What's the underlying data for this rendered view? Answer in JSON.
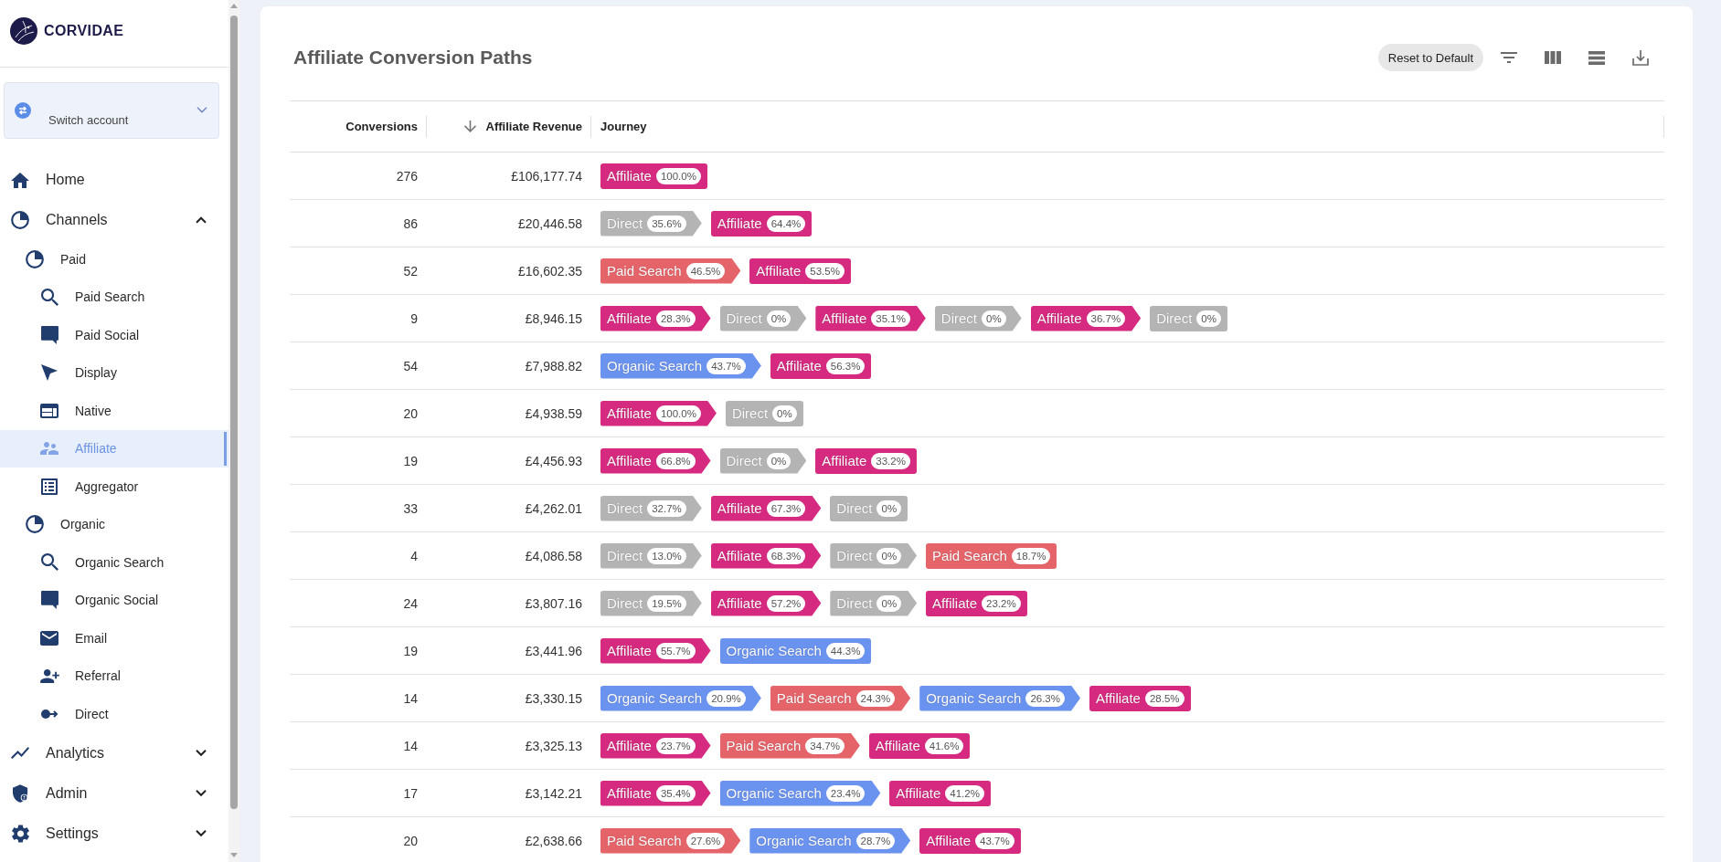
{
  "sidebar": {
    "brand": "CORVIDAE",
    "account_switcher": {
      "label": "Switch account",
      "expanded": false
    },
    "nav": [
      {
        "label": "Home",
        "selected": false
      },
      {
        "label": "Channels",
        "selected": false,
        "expanded": true,
        "children": [
          {
            "label": "Paid",
            "selected": false,
            "children": [
              {
                "label": "Paid Search",
                "selected": false
              },
              {
                "label": "Paid Social",
                "selected": false
              },
              {
                "label": "Display",
                "selected": false
              },
              {
                "label": "Native",
                "selected": false
              },
              {
                "label": "Affiliate",
                "selected": true
              },
              {
                "label": "Aggregator",
                "selected": false
              }
            ]
          },
          {
            "label": "Organic",
            "selected": false,
            "children": [
              {
                "label": "Organic Search",
                "selected": false
              },
              {
                "label": "Organic Social",
                "selected": false
              },
              {
                "label": "Email",
                "selected": false
              },
              {
                "label": "Referral",
                "selected": false
              },
              {
                "label": "Direct",
                "selected": false
              }
            ]
          }
        ]
      },
      {
        "label": "Analytics",
        "selected": false,
        "expanded": false
      },
      {
        "label": "Admin",
        "selected": false,
        "expanded": false
      },
      {
        "label": "Settings",
        "selected": false,
        "expanded": false
      }
    ]
  },
  "page": {
    "title": "Affiliate Conversion Paths",
    "reset_button": "Reset to Default",
    "table": {
      "columns": [
        {
          "label": "Conversions",
          "sorted_descending": false
        },
        {
          "label": "Affiliate Revenue",
          "sorted_descending": true
        },
        {
          "label": "Journey",
          "sorted_descending": false
        }
      ],
      "rows": [
        {
          "conversions": "276",
          "revenue": "£106,177.74",
          "journey": [
            {
              "channel": "Affiliate",
              "share": "100.0%",
              "color": "#d62a80"
            }
          ]
        },
        {
          "conversions": "86",
          "revenue": "£20,446.58",
          "journey": [
            {
              "channel": "Direct",
              "share": "35.6%",
              "color": "#b4b4b4"
            },
            {
              "channel": "Affiliate",
              "share": "64.4%",
              "color": "#d62a80"
            }
          ]
        },
        {
          "conversions": "52",
          "revenue": "£16,602.35",
          "journey": [
            {
              "channel": "Paid Search",
              "share": "46.5%",
              "color": "#e5646a"
            },
            {
              "channel": "Affiliate",
              "share": "53.5%",
              "color": "#d62a80"
            }
          ]
        },
        {
          "conversions": "9",
          "revenue": "£8,946.15",
          "journey": [
            {
              "channel": "Affiliate",
              "share": "28.3%",
              "color": "#d62a80"
            },
            {
              "channel": "Direct",
              "share": "0%",
              "color": "#b4b4b4"
            },
            {
              "channel": "Affiliate",
              "share": "35.1%",
              "color": "#d62a80"
            },
            {
              "channel": "Direct",
              "share": "0%",
              "color": "#b4b4b4"
            },
            {
              "channel": "Affiliate",
              "share": "36.7%",
              "color": "#d62a80"
            },
            {
              "channel": "Direct",
              "share": "0%",
              "color": "#b4b4b4"
            }
          ]
        },
        {
          "conversions": "54",
          "revenue": "£7,988.82",
          "journey": [
            {
              "channel": "Organic Search",
              "share": "43.7%",
              "color": "#6a92ef"
            },
            {
              "channel": "Affiliate",
              "share": "56.3%",
              "color": "#d62a80"
            }
          ]
        },
        {
          "conversions": "20",
          "revenue": "£4,938.59",
          "journey": [
            {
              "channel": "Affiliate",
              "share": "100.0%",
              "color": "#d62a80"
            },
            {
              "channel": "Direct",
              "share": "0%",
              "color": "#b4b4b4"
            }
          ]
        },
        {
          "conversions": "19",
          "revenue": "£4,456.93",
          "journey": [
            {
              "channel": "Affiliate",
              "share": "66.8%",
              "color": "#d62a80"
            },
            {
              "channel": "Direct",
              "share": "0%",
              "color": "#b4b4b4"
            },
            {
              "channel": "Affiliate",
              "share": "33.2%",
              "color": "#d62a80"
            }
          ]
        },
        {
          "conversions": "33",
          "revenue": "£4,262.01",
          "journey": [
            {
              "channel": "Direct",
              "share": "32.7%",
              "color": "#b4b4b4"
            },
            {
              "channel": "Affiliate",
              "share": "67.3%",
              "color": "#d62a80"
            },
            {
              "channel": "Direct",
              "share": "0%",
              "color": "#b4b4b4"
            }
          ]
        },
        {
          "conversions": "4",
          "revenue": "£4,086.58",
          "journey": [
            {
              "channel": "Direct",
              "share": "13.0%",
              "color": "#b4b4b4"
            },
            {
              "channel": "Affiliate",
              "share": "68.3%",
              "color": "#d62a80"
            },
            {
              "channel": "Direct",
              "share": "0%",
              "color": "#b4b4b4"
            },
            {
              "channel": "Paid Search",
              "share": "18.7%",
              "color": "#e5646a"
            }
          ]
        },
        {
          "conversions": "24",
          "revenue": "£3,807.16",
          "journey": [
            {
              "channel": "Direct",
              "share": "19.5%",
              "color": "#b4b4b4"
            },
            {
              "channel": "Affiliate",
              "share": "57.2%",
              "color": "#d62a80"
            },
            {
              "channel": "Direct",
              "share": "0%",
              "color": "#b4b4b4"
            },
            {
              "channel": "Affiliate",
              "share": "23.2%",
              "color": "#d62a80"
            }
          ]
        },
        {
          "conversions": "19",
          "revenue": "£3,441.96",
          "journey": [
            {
              "channel": "Affiliate",
              "share": "55.7%",
              "color": "#d62a80"
            },
            {
              "channel": "Organic Search",
              "share": "44.3%",
              "color": "#6a92ef"
            }
          ]
        },
        {
          "conversions": "14",
          "revenue": "£3,330.15",
          "journey": [
            {
              "channel": "Organic Search",
              "share": "20.9%",
              "color": "#6a92ef"
            },
            {
              "channel": "Paid Search",
              "share": "24.3%",
              "color": "#e5646a"
            },
            {
              "channel": "Organic Search",
              "share": "26.3%",
              "color": "#6a92ef"
            },
            {
              "channel": "Affiliate",
              "share": "28.5%",
              "color": "#d62a80"
            }
          ]
        },
        {
          "conversions": "14",
          "revenue": "£3,325.13",
          "journey": [
            {
              "channel": "Affiliate",
              "share": "23.7%",
              "color": "#d62a80"
            },
            {
              "channel": "Paid Search",
              "share": "34.7%",
              "color": "#e5646a"
            },
            {
              "channel": "Affiliate",
              "share": "41.6%",
              "color": "#d62a80"
            }
          ]
        },
        {
          "conversions": "17",
          "revenue": "£3,142.21",
          "journey": [
            {
              "channel": "Affiliate",
              "share": "35.4%",
              "color": "#d62a80"
            },
            {
              "channel": "Organic Search",
              "share": "23.4%",
              "color": "#6a92ef"
            },
            {
              "channel": "Affiliate",
              "share": "41.2%",
              "color": "#d62a80"
            }
          ]
        },
        {
          "conversions": "20",
          "revenue": "£2,638.66",
          "journey": [
            {
              "channel": "Paid Search",
              "share": "27.6%",
              "color": "#e5646a"
            },
            {
              "channel": "Organic Search",
              "share": "28.7%",
              "color": "#6a92ef"
            },
            {
              "channel": "Affiliate",
              "share": "43.7%",
              "color": "#d62a80"
            }
          ]
        }
      ]
    }
  }
}
